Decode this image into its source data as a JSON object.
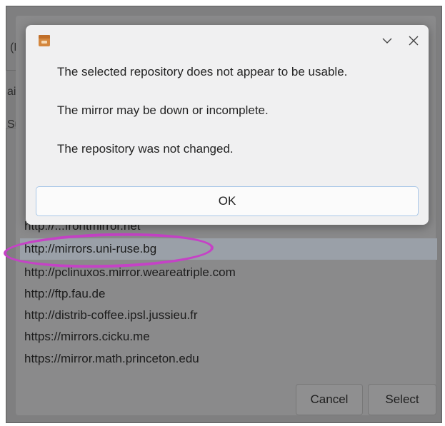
{
  "background_window": {
    "edge_fragments": [
      "(R",
      "ail",
      "Su"
    ],
    "mirrors": [
      {
        "url": "http://...frontmirror.net",
        "selected": false
      },
      {
        "url": "http://mirrors.uni-ruse.bg",
        "selected": true
      },
      {
        "url": "http://pclinuxos.mirror.weareatriple.com",
        "selected": false
      },
      {
        "url": "http://ftp.fau.de",
        "selected": false
      },
      {
        "url": "http://distrib-coffee.ipsl.jussieu.fr",
        "selected": false
      },
      {
        "url": "https://mirrors.cicku.me",
        "selected": false
      },
      {
        "url": "https://mirror.math.princeton.edu",
        "selected": false
      }
    ],
    "cancel_label": "Cancel",
    "select_label": "Select"
  },
  "dialog": {
    "icon": "package-icon",
    "messages": [
      "The selected repository does not appear to be usable.",
      "The mirror may be down or incomplete.",
      "The repository was not changed."
    ],
    "ok_label": "OK"
  },
  "annotation": {
    "color": "#c542c6"
  }
}
